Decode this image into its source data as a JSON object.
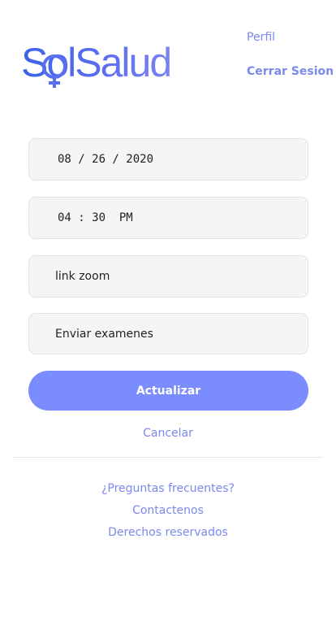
{
  "brand": {
    "logo_text": "SolSalud",
    "accent": "#7b88ee",
    "logo_color": "#3d62e8",
    "logo_icon": "venus-symbol-icon"
  },
  "nav": {
    "profile_label": "Perfil",
    "logout_label": "Cerrar Sesion"
  },
  "form": {
    "date_value": "08 / 26 / 2020",
    "time_value": "04 : 30  PM",
    "link_value": "link zoom",
    "exams_value": "Enviar examenes",
    "submit_label": "Actualizar",
    "cancel_label": "Cancelar",
    "button_color": "#7b8cff"
  },
  "footer": {
    "faq_label": "¿Preguntas frecuentes?",
    "contact_label": "Contactenos",
    "rights_label": "Derechos reservados"
  }
}
